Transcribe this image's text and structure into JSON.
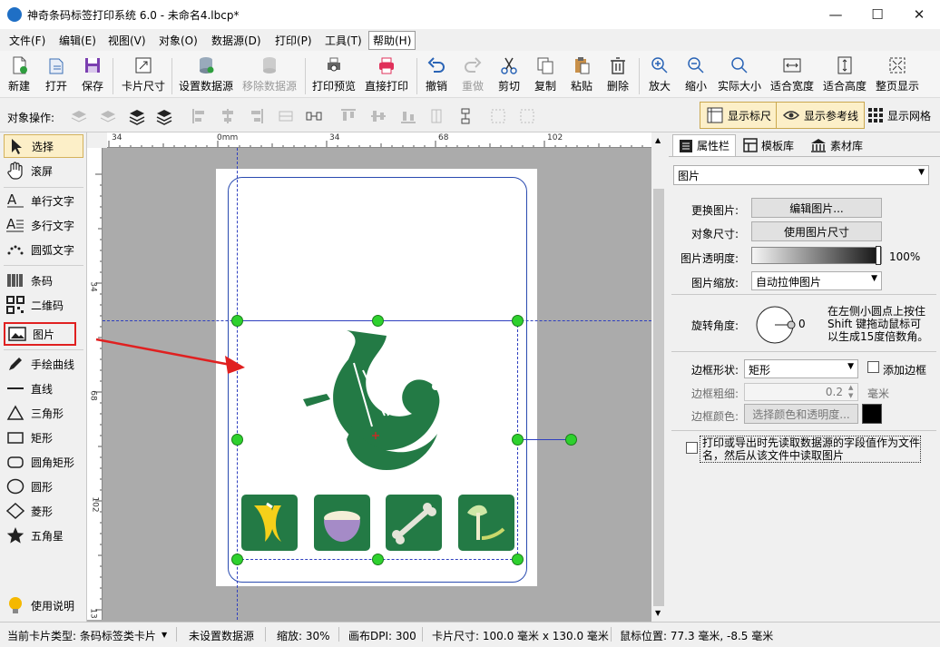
{
  "window": {
    "title": "神奇条码标签打印系统 6.0 - 未命名4.lbcp*",
    "min": "—",
    "max": "☐",
    "close": "✕"
  },
  "menu": [
    "文件(F)",
    "编辑(E)",
    "视图(V)",
    "对象(O)",
    "数据源(D)",
    "打印(P)",
    "工具(T)",
    "帮助(H)"
  ],
  "toolbar": {
    "new": "新建",
    "open": "打开",
    "save": "保存",
    "card_size": "卡片尺寸",
    "set_datasource": "设置数据源",
    "remove_datasource": "移除数据源",
    "print_preview": "打印预览",
    "direct_print": "直接打印",
    "undo": "撤销",
    "redo": "重做",
    "cut": "剪切",
    "copy": "复制",
    "paste": "粘贴",
    "delete": "删除",
    "zoom_in": "放大",
    "zoom_out": "缩小",
    "actual_size": "实际大小",
    "fit_width": "适合宽度",
    "fit_height": "适合高度",
    "fit_page": "整页显示"
  },
  "objbar": {
    "label": "对象操作:",
    "show_ruler": "显示标尺",
    "show_guides": "显示参考线",
    "show_grid": "显示网格"
  },
  "tools": [
    "选择",
    "滚屏",
    "单行文字",
    "多行文字",
    "圆弧文字",
    "条码",
    "二维码",
    "图片",
    "手绘曲线",
    "直线",
    "三角形",
    "矩形",
    "圆角矩形",
    "圆形",
    "菱形",
    "五角星",
    "使用说明"
  ],
  "ruler": {
    "h": [
      "34",
      "0mm",
      "34",
      "68",
      "102"
    ],
    "v": [
      "34",
      "68",
      "102",
      "13"
    ]
  },
  "panel": {
    "tabs": [
      "属性栏",
      "模板库",
      "素材库"
    ],
    "object_type": "图片",
    "change_image_label": "更换图片:",
    "edit_image_btn": "编辑图片...",
    "object_size_label": "对象尺寸:",
    "use_image_size_btn": "使用图片尺寸",
    "opacity_label": "图片透明度:",
    "opacity_value": "100%",
    "opacity": 1.0,
    "scale_label": "图片缩放:",
    "scale_value": "自动拉伸图片",
    "rotation_label": "旋转角度:",
    "rotation_value": "0",
    "rotation_hint": [
      "在左侧小圆点上按住",
      "Shift 键拖动鼠标可",
      "以生成15度倍数角。"
    ],
    "border_shape_label": "边框形状:",
    "border_shape_value": "矩形",
    "add_border_label": "添加边框",
    "border_width_label": "边框粗细:",
    "border_width_value": "0.2",
    "border_width_unit": "毫米",
    "border_color_label": "边框颜色:",
    "border_color_btn": "选择颜色和透明度...",
    "border_color": "#000000",
    "read_from_file_label": [
      "打印或导出时先读取数据源的字段值作为文件",
      "名，然后从该文件中读取图片"
    ]
  },
  "status": {
    "card_type": "当前卡片类型: 条码标签类卡片",
    "datasource": "未设置数据源",
    "zoom": "缩放: 30%",
    "dpi": "画布DPI: 300",
    "card_size": "卡片尺寸: 100.0 毫米 x 130.0 毫米",
    "mouse_pos": "鼠标位置: 77.3 毫米, -8.5 毫米"
  },
  "colors": {
    "accent": "#1f6fc5",
    "handle": "#2ed12e",
    "tile": "#237a45",
    "arrow": "#e02020"
  }
}
